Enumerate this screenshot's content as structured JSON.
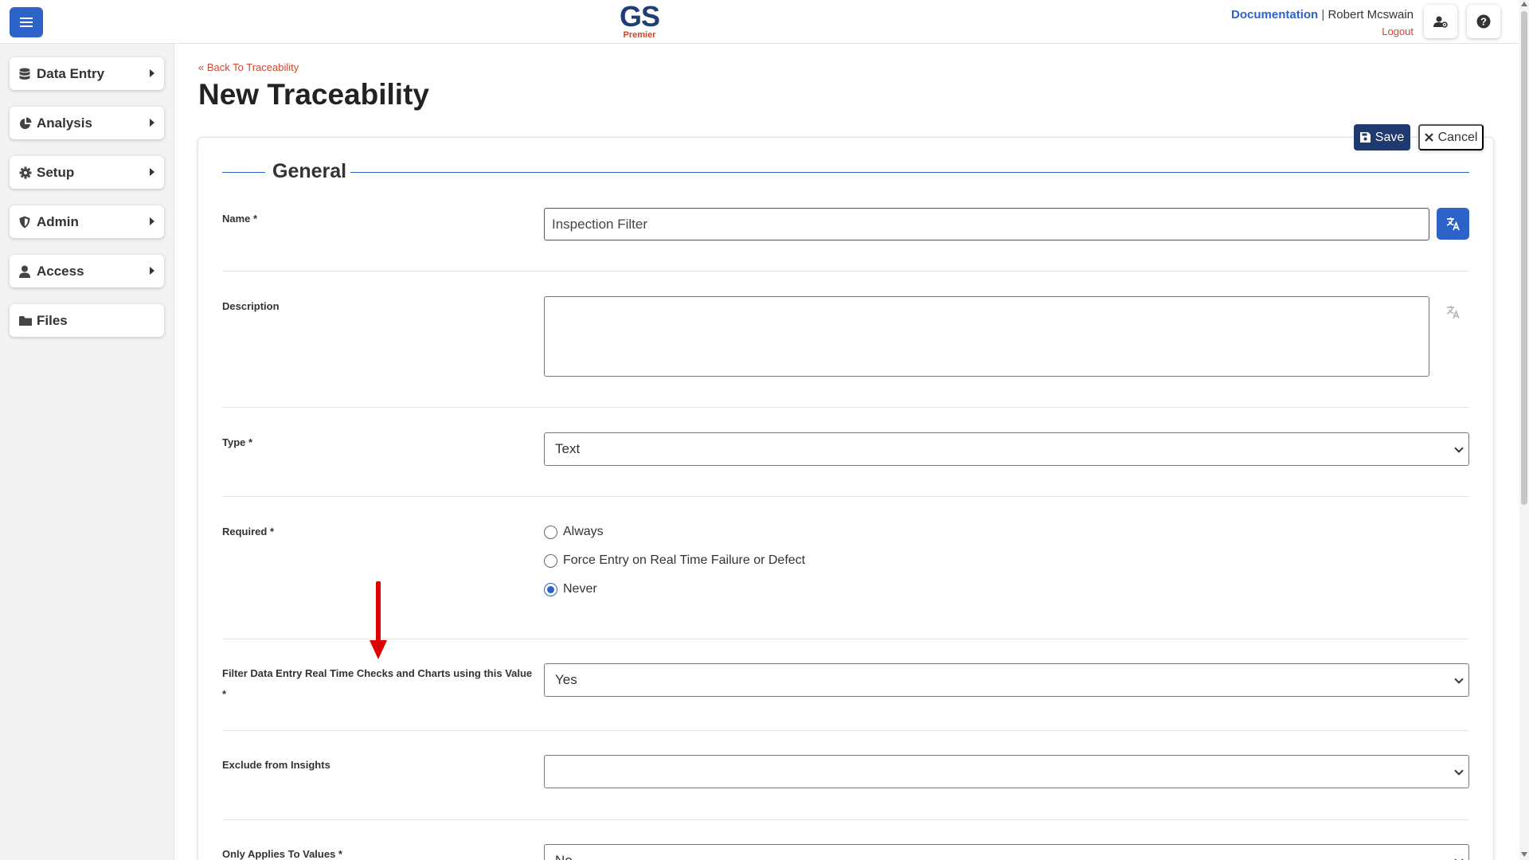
{
  "header": {
    "logo_text": "GS",
    "logo_sub": "Premier",
    "documentation": "Documentation",
    "separator": "|",
    "user_name": "Robert Mcswain",
    "logout": "Logout"
  },
  "sidebar": {
    "items": [
      {
        "label": "Data Entry",
        "icon": "database-icon"
      },
      {
        "label": "Analysis",
        "icon": "pie-chart-icon"
      },
      {
        "label": "Setup",
        "icon": "gear-icon"
      },
      {
        "label": "Admin",
        "icon": "shield-icon"
      },
      {
        "label": "Access",
        "icon": "user-icon"
      },
      {
        "label": "Files",
        "icon": "folder-icon"
      }
    ]
  },
  "page": {
    "back_link": "Back To Traceability",
    "title": "New Traceability",
    "save": "Save",
    "cancel": "Cancel",
    "section": "General"
  },
  "form": {
    "name_label": "Name *",
    "name_value": "Inspection Filter",
    "description_label": "Description",
    "description_value": "",
    "type_label": "Type *",
    "type_value": "Text",
    "required_label": "Required *",
    "required_options": [
      "Always",
      "Force Entry on Real Time Failure or Defect",
      "Never"
    ],
    "required_selected": "Never",
    "filter_label": "Filter Data Entry Real Time Checks and Charts using this Value *",
    "filter_value": "Yes",
    "exclude_label": "Exclude from Insights",
    "exclude_value": "",
    "only_applies_label": "Only Applies To Values *",
    "only_applies_value": "No"
  },
  "colors": {
    "primary": "#2d63c8",
    "dark_navy": "#1e3a6e",
    "accent_red": "#d2472b",
    "annotation_arrow": "#e10000"
  }
}
